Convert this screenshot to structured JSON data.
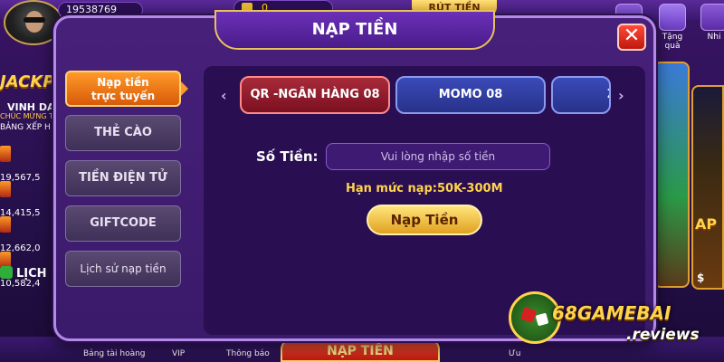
{
  "header": {
    "user_coins": "19538769",
    "gold_value": "0",
    "withdraw_label": "RÚT TIỀN",
    "gift_label": "Tặng quà",
    "more_label": "Nhi"
  },
  "lobby": {
    "jackpot_label": "JACKP",
    "vinh_danh": "VINH DA",
    "chuc_mung": "CHÚC MỪNG T",
    "bang_xep_hang": "BẢNG XẾP H",
    "ranks": [
      "19,567,5",
      "14,415,5",
      "12,662,0",
      "10,582,4"
    ],
    "history_label": "LỊCH S",
    "card2_label": "AP",
    "card2_dollar": "$",
    "bottom_nav": [
      "Bảng tài hoàng",
      "VIP",
      "Thông báo",
      "Ưu"
    ]
  },
  "modal": {
    "title": "NẠP TIỀN",
    "close_symbol": "✕",
    "side_tabs": [
      {
        "label_line1": "Nạp tiền",
        "label_line2": "trực tuyến",
        "active": true
      },
      {
        "label": "THẺ CÀO"
      },
      {
        "label": "TIỀN ĐIỆN TỬ"
      },
      {
        "label": "GIFTCODE"
      },
      {
        "label": "Lịch sử nạp tiền"
      }
    ],
    "methods": [
      "QR -NGÂN HÀNG 08",
      "MOMO 08",
      "Z"
    ],
    "selected_method": "QR -NGÂN HÀNG 08",
    "amount_label": "Số Tiền:",
    "amount_placeholder": "Vui lòng nhập số tiền",
    "amount_value": "",
    "limit_text": "Hạn mức nạp:50K-300M",
    "submit_label": "Nạp Tiền"
  },
  "bottom_bar": {
    "deposit_label": "NẠP TIỀN"
  },
  "watermark": {
    "brand": "68GAMEBAI",
    "domain": ".reviews"
  },
  "colors": {
    "accent_orange": "#ff9a2a",
    "selected_method": "#a82a3a",
    "method_blue": "#3a4ab8",
    "limit_yellow": "#ffd34a",
    "submit_gold": "#ffe57a"
  }
}
